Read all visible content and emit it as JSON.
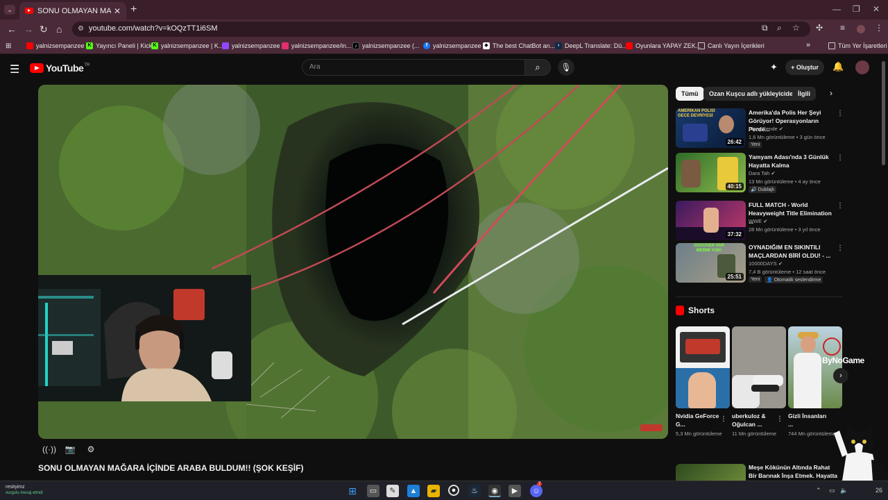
{
  "browser": {
    "tab_title": "SONU OLMAYAN MAĞARA İÇİN",
    "url": "youtube.com/watch?v=kOQzTT1i6SM",
    "bookmarks": [
      "yalnizsempanzee",
      "Yayıncı Paneli | Kick",
      "yalnizsempanzee | K...",
      "yalnizsempanzee",
      "yalnizsempanzee/in...",
      "yalnizsempanzee (...",
      "yalnizsempanzee",
      "The best ChatBot an...",
      "DeepL Translate: Dü...",
      "Oyunlara YAPAY ZEK...",
      "Canlı Yayın İçerikleri"
    ],
    "all_bookmarks": "Tüm Yer İşaretleri"
  },
  "youtube": {
    "logo_text": "YouTube",
    "logo_region": "TR",
    "search_placeholder": "Ara",
    "create_label": "Oluştur",
    "video_title": "SONU OLMAYAN MAĞARA İÇİNDE ARABA BULDUM!! (ŞOK KEŞİF)",
    "chips": [
      "Tümü",
      "Ozan Kuşcu adlı yükleyiciden",
      "İlgili"
    ],
    "recommendations": [
      {
        "title": "Amerika'da Polis Her Şeyi Görüyor! Operasyonların Perde...",
        "channel": "Alper Rende",
        "meta": "1,6 Mn görüntüleme • 3 gün önce",
        "duration": "26:42",
        "badge": "Yeni",
        "thumb_text": "AMERIKAN POLİSİ GECE DEVRİYESİ"
      },
      {
        "title": "Yamyam Adası'nda 3 Günlük Hayatta Kalma",
        "channel": "Dara Tah",
        "meta": "13 Mn görüntüleme • 4 ay önce",
        "duration": "40:15",
        "badge": "Dublajlı"
      },
      {
        "title": "FULL MATCH - World Heavyweight Title Elimination ...",
        "channel": "WWE",
        "meta": "28 Mn görüntüleme • 3 yıl önce",
        "duration": "37:32"
      },
      {
        "title": "OYNADIĞIM EN SIKINTILI MAÇLARDAN BİRİ OLDU! - ...",
        "channel": "10000DAYS",
        "meta": "7,4 B görüntüleme • 12 saat önce",
        "duration": "25:51",
        "badge": "Yeni",
        "badge2": "Otomatik seslendirme",
        "thumb_text": "ÖZGÜVEN VAR MERMİ YOK!"
      }
    ],
    "shorts_heading": "Shorts",
    "shorts": [
      {
        "title": "Nvidia GeForce G...",
        "views": "5,3 Mn görüntüleme"
      },
      {
        "title": "uberkuloz & Oğulcan ...",
        "views": "11 Mn görüntüleme"
      },
      {
        "title": "Gizli İnsanları ...",
        "views": "744 Mn görüntüleme"
      }
    ],
    "overlay_brand": "ByNoGame",
    "last_rec_title": "Meşe Kökünün Altında Rahat Bir Barınak İnşa Etmek. Hayatta ..."
  },
  "taskbar": {
    "user": "resityimz",
    "user_sub": "vurgulu mesaj etmdi",
    "discord_badge": "7",
    "clock": "26"
  },
  "colors": {
    "tab_bg": "#3a1f2b",
    "youtube_red": "#ff0000",
    "page_bg": "#0f0f0f"
  }
}
